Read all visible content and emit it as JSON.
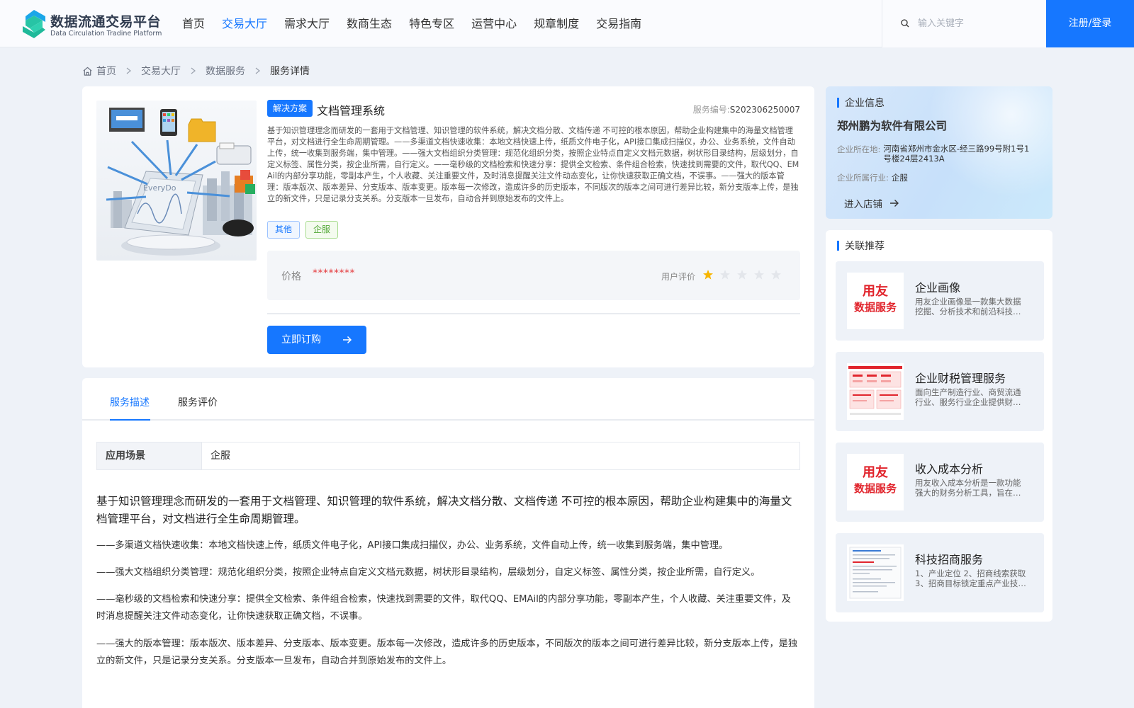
{
  "header": {
    "logo_cn": "数据流通交易平台",
    "logo_en": "Data Circulation Tradine Platform",
    "nav": [
      "首页",
      "交易大厅",
      "需求大厅",
      "数商生态",
      "特色专区",
      "运营中心",
      "规章制度",
      "交易指南"
    ],
    "active_nav": "交易大厅",
    "search_placeholder": "输入关键字",
    "login_label": "注册/登录"
  },
  "breadcrumb": [
    "首页",
    "交易大厅",
    "数据服务",
    "服务详情"
  ],
  "product": {
    "tag": "解决方案",
    "title": "文档管理系统",
    "service_no_label": "服务编号:",
    "service_no": "S202306250007",
    "desc": "基于知识管理理念而研发的一套用于文档管理、知识管理的软件系统，解决文档分散、文档传递 不可控的根本原因，帮助企业构建集中的海量文档管理平台，对文档进行全生命周期管理。——多渠道文档快速收集：本地文档快速上传，纸质文件电子化，API接口集成扫描仪，办公、业务系统，文件自动上传，统一收集到服务端，集中管理。——强大文档组织分类管理：规范化组织分类，按照企业特点自定义文档元数据，树状形目录结构，层级划分，自定义标签、属性分类，按企业所需，自行定义。——毫秒级的文档检索和快速分享：提供全文检索、条件组合检索，快速找到需要的文件，取代QQ、EMAil的内部分享功能，零副本产生，个人收藏、关注重要文件，及时消息提醒关注文件动态变化，让你快速获取正确文档，不误事。——强大的版本管理：版本版次、版本差异、分支版本、版本变更。版本每一次修改，造成许多的历史版本，不同版次的版本之间可进行差异比较，新分支版本上传，是独立的新文件，只是记录分支关系。分支版本一旦发布，自动合并到原始发布的文件上。",
    "tags": [
      "其他",
      "企服"
    ],
    "image_text": "EveryDo",
    "price_label": "价格",
    "price": "********",
    "rating_label": "用户评价",
    "rating": 1,
    "rating_max": 5,
    "subscribe_label": "立即订购"
  },
  "company": {
    "section_title": "企业信息",
    "name": "郑州鹏为软件有限公司",
    "location_label": "企业所在地:",
    "location": "河南省郑州市金水区-经三路99号附1号1号楼24层2413A",
    "industry_label": "企业所属行业:",
    "industry": "企服",
    "enter_label": "进入店铺"
  },
  "recommend": {
    "section_title": "关联推荐",
    "items": [
      {
        "title": "企业画像",
        "desc": "用友企业画像是一款集大数据挖掘、分析技术和前沿科技…",
        "thumb": "yongyou",
        "brand1": "用友",
        "brand2": "数据服务"
      },
      {
        "title": "企业财税管理服务",
        "desc": "面向生产制造行业、商贸流通行业、服务行业企业提供财…",
        "thumb": "table"
      },
      {
        "title": "收入成本分析",
        "desc": "用友收入成本分析是一款功能强大的财务分析工具，旨在…",
        "thumb": "yongyou",
        "brand1": "用友",
        "brand2": "数据服务"
      },
      {
        "title": "科技招商服务",
        "desc": "1、产业定位 2、招商线索获取 3、招商目标锁定重点产业技…",
        "thumb": "doc"
      }
    ]
  },
  "detail": {
    "tabs": [
      "服务描述",
      "服务评价"
    ],
    "active_tab": "服务描述",
    "scene_label": "应用场景",
    "scene_value": "企服",
    "lead": "基于知识管理理念而研发的一套用于文档管理、知识管理的软件系统，解决文档分散、文档传递 不可控的根本原因，帮助企业构建集中的海量文档管理平台，对文档进行全生命周期管理。",
    "p1": "——多渠道文档快速收集：本地文档快速上传，纸质文件电子化，API接口集成扫描仪，办公、业务系统，文件自动上传，统一收集到服务端，集中管理。",
    "p2": "——强大文档组织分类管理：规范化组织分类，按照企业特点自定义文档元数据，树状形目录结构，层级划分，自定义标签、属性分类，按企业所需，自行定义。",
    "p3": "——毫秒级的文档检索和快速分享：提供全文检索、条件组合检索，快速找到需要的文件，取代QQ、EMAil的内部分享功能，零副本产生，个人收藏、关注重要文件，及时消息提醒关注文件动态变化，让你快速获取正确文档，不误事。",
    "p4": "——强大的版本管理：版本版次、版本差异、分支版本、版本变更。版本每一次修改，造成许多的历史版本，不同版次的版本之间可进行差异比较，新分支版本上传，是独立的新文件，只是记录分支关系。分支版本一旦发布，自动合并到原始发布的文件上。"
  }
}
